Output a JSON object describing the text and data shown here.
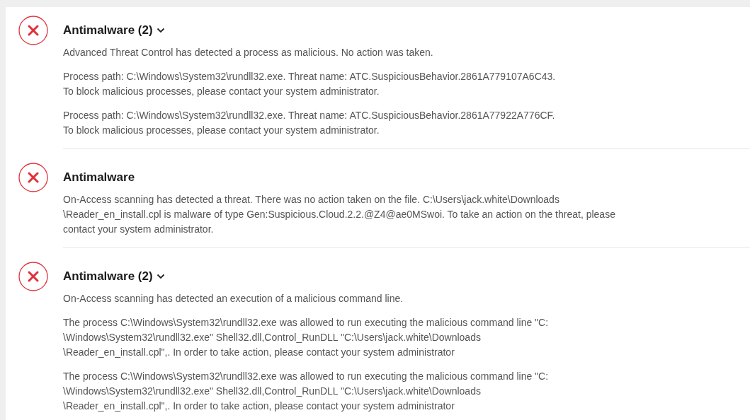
{
  "events": [
    {
      "title": "Antimalware (2)",
      "collapsible": true,
      "messages": [
        {
          "lines": [
            "Advanced Threat Control has detected a process as malicious. No action was taken."
          ]
        },
        {
          "lines": [
            "Process path: C:\\Windows\\System32\\rundll32.exe. Threat name: ATC.SuspiciousBehavior.2861A779107A6C43.",
            "To block malicious processes, please contact your system administrator."
          ]
        },
        {
          "lines": [
            "Process path: C:\\Windows\\System32\\rundll32.exe. Threat name: ATC.SuspiciousBehavior.2861A77922A776CF.",
            "To block malicious processes, please contact your system administrator."
          ]
        }
      ]
    },
    {
      "title": "Antimalware",
      "collapsible": false,
      "messages": [
        {
          "lines": [
            "On-Access scanning has detected a threat. There was no action taken on the file. C:\\Users\\jack.white\\Downloads",
            "\\Reader_en_install.cpl is malware of type Gen:Suspicious.Cloud.2.2.@Z4@ae0MSwoi. To take an action on the threat, please",
            "contact your system administrator."
          ]
        }
      ]
    },
    {
      "title": "Antimalware (2)",
      "collapsible": true,
      "messages": [
        {
          "lines": [
            "On-Access scanning has detected an execution of a malicious command line."
          ]
        },
        {
          "lines": [
            "The process C:\\Windows\\System32\\rundll32.exe was allowed to run executing the malicious command line \"C:",
            "\\Windows\\System32\\rundll32.exe\" Shell32.dll,Control_RunDLL \"C:\\Users\\jack.white\\Downloads",
            "\\Reader_en_install.cpl\",. In order to take action, please contact your system administrator"
          ]
        },
        {
          "lines": [
            "The process C:\\Windows\\System32\\rundll32.exe was allowed to run executing the malicious command line \"C:",
            "\\Windows\\System32\\rundll32.exe\" Shell32.dll,Control_RunDLL \"C:\\Users\\jack.white\\Downloads",
            "\\Reader_en_install.cpl\",. In order to take action, please contact your system administrator"
          ]
        }
      ]
    }
  ]
}
